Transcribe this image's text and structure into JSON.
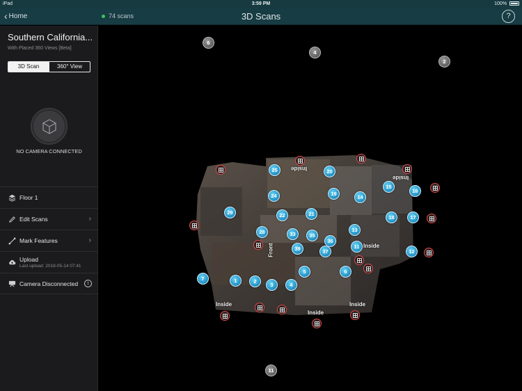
{
  "status_bar": {
    "device": "iPad",
    "time": "3:59 PM",
    "battery": "100%"
  },
  "nav": {
    "back_label": "Home",
    "scan_count": "74 scans",
    "title": "3D Scans",
    "help_label": "?"
  },
  "colors": {
    "nav_bg": "#173c43",
    "sidebar_bg": "#1b1b1d",
    "marker_blue": "#1e8fc3",
    "pano_ring": "#e24a4a",
    "connected_dot": "#3ec25b"
  },
  "project": {
    "title": "Southern California...",
    "subtitle": "With Placed 360 Views [Beta]",
    "tabs": [
      "3D Scan",
      "360° View"
    ],
    "selected_tab": "3D Scan"
  },
  "camera": {
    "status": "NO CAMERA CONNECTED",
    "icon": "cube-icon"
  },
  "menu": {
    "floor": {
      "label": "Floor 1",
      "icon": "layers-icon"
    },
    "edit_scans": {
      "label": "Edit Scans",
      "icon": "pencil-icon"
    },
    "mark_features": {
      "label": "Mark Features",
      "icon": "ruler-icon"
    },
    "upload": {
      "label": "Upload",
      "sub": "Last upload: 2018-05-14 07:41",
      "icon": "cloud-upload-icon"
    },
    "camera_disconnected": {
      "label": "Camera Disconnected",
      "icon": "camera-icon",
      "info": "i"
    }
  },
  "map": {
    "room_labels": [
      "Inside",
      "Inside",
      "Inside",
      "Inside",
      "Inside",
      "Inside",
      "Front"
    ],
    "scan_markers": [
      "1",
      "2",
      "3",
      "4",
      "5",
      "6",
      "7",
      "11",
      "12",
      "13",
      "14",
      "15",
      "16",
      "17",
      "18",
      "19",
      "20",
      "21",
      "22",
      "24",
      "25",
      "28",
      "29",
      "33",
      "35",
      "36",
      "37",
      "39"
    ],
    "outlier_markers": [
      "6",
      "4",
      "2",
      "11"
    ]
  }
}
